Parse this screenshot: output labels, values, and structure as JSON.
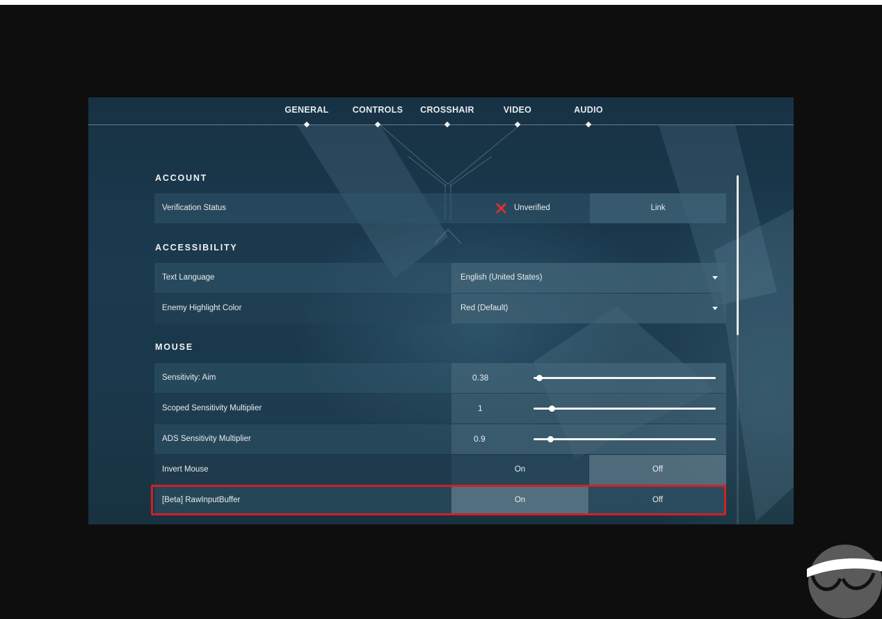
{
  "tabs": [
    "GENERAL",
    "CONTROLS",
    "CROSSHAIR",
    "VIDEO",
    "AUDIO"
  ],
  "active_tab": "GENERAL",
  "sections": {
    "account": {
      "title": "ACCOUNT",
      "verification": {
        "label": "Verification Status",
        "status": "Unverified",
        "status_icon": "x-icon",
        "status_icon_color": "#e0302b",
        "action": "Link"
      }
    },
    "accessibility": {
      "title": "ACCESSIBILITY",
      "text_language": {
        "label": "Text Language",
        "value": "English (United States)"
      },
      "enemy_highlight": {
        "label": "Enemy Highlight Color",
        "value": "Red (Default)"
      }
    },
    "mouse": {
      "title": "MOUSE",
      "sensitivity_aim": {
        "label": "Sensitivity: Aim",
        "value": "0.38",
        "slider_fraction": 0.03
      },
      "scoped_multiplier": {
        "label": "Scoped Sensitivity Multiplier",
        "value": "1",
        "slider_fraction": 0.1
      },
      "ads_multiplier": {
        "label": "ADS Sensitivity Multiplier",
        "value": "0.9",
        "slider_fraction": 0.09
      },
      "invert_mouse": {
        "label": "Invert Mouse",
        "on_label": "On",
        "off_label": "Off",
        "selected": "Off"
      },
      "raw_input": {
        "label": "[Beta] RawInputBuffer",
        "on_label": "On",
        "off_label": "Off",
        "selected": "On"
      }
    }
  },
  "colors": {
    "highlight_border": "#d51f26",
    "accent_white": "#f4f4f4"
  }
}
